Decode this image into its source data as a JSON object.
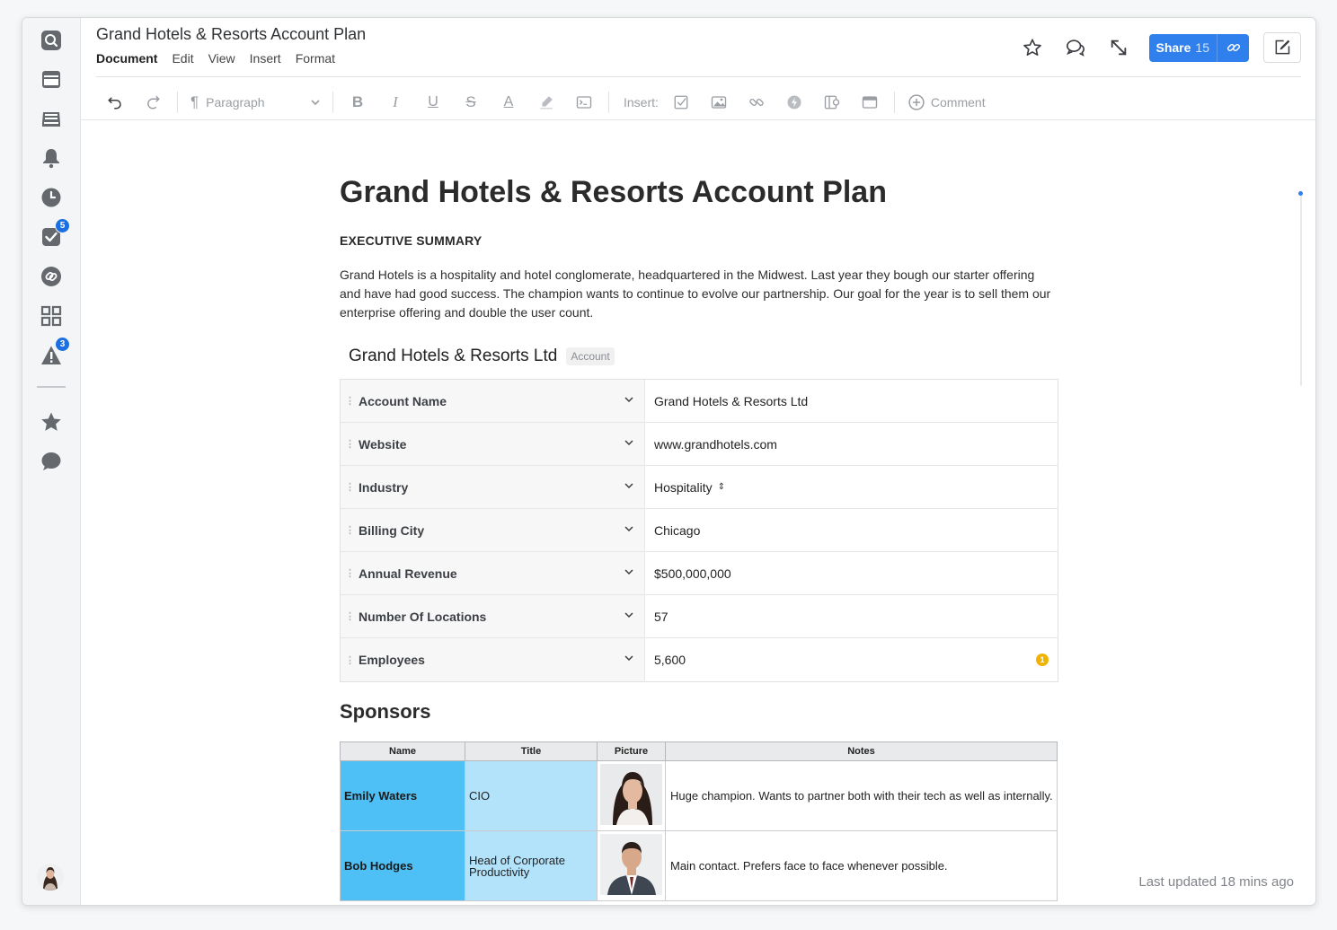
{
  "header": {
    "title": "Grand Hotels & Resorts Account Plan",
    "menu": [
      "Document",
      "Edit",
      "View",
      "Insert",
      "Format"
    ],
    "share_label": "Share",
    "share_count": "15"
  },
  "rail": {
    "icons": [
      "search-icon",
      "calendar-icon",
      "inbox-icon",
      "bell-icon",
      "clock-icon",
      "tasks-icon",
      "link-icon",
      "apps-grid-icon",
      "warning-icon",
      "star-icon",
      "chat-icon"
    ],
    "tasks_badge": "5",
    "warning_badge": "3"
  },
  "toolbar": {
    "paragraph_label": "Paragraph",
    "insert_label": "Insert:",
    "comment_label": "Comment"
  },
  "doc": {
    "title": "Grand Hotels & Resorts Account Plan",
    "section_heading": "EXECUTIVE SUMMARY",
    "summary": "Grand Hotels is a hospitality and hotel conglomerate, headquartered in the Midwest. Last year they bough our starter offering and have had good success. The champion wants to continue to evolve our partnership. Our goal for the year is to sell them our enterprise offering and double the user count."
  },
  "account": {
    "title": "Grand Hotels & Resorts Ltd",
    "tag": "Account",
    "fields": [
      {
        "label": "Account Name",
        "value": "Grand Hotels & Resorts Ltd"
      },
      {
        "label": "Website",
        "value": "www.grandhotels.com"
      },
      {
        "label": "Industry",
        "value": "Hospitality"
      },
      {
        "label": "Billing City",
        "value": "Chicago"
      },
      {
        "label": "Annual Revenue",
        "value": "$500,000,000"
      },
      {
        "label": "Number Of Locations",
        "value": "57"
      },
      {
        "label": "Employees",
        "value": "5,600"
      }
    ],
    "employees_flag": "1"
  },
  "sponsors": {
    "heading": "Sponsors",
    "columns": [
      "Name",
      "Title",
      "Picture",
      "Notes"
    ],
    "rows": [
      {
        "name": "Emily Waters",
        "title": "CIO",
        "notes": "Huge champion. Wants to partner both with their tech as well as internally."
      },
      {
        "name": "Bob Hodges",
        "title": "Head of Corporate Productivity",
        "notes": "Main contact. Prefers face to face whenever possible."
      }
    ]
  },
  "footer": {
    "last_updated": "Last updated 18 mins ago"
  },
  "colors": {
    "accent": "#2f80ed",
    "name_cell": "#4fc0f5",
    "title_cell": "#b3e3fb",
    "warning": "#f0b400"
  }
}
